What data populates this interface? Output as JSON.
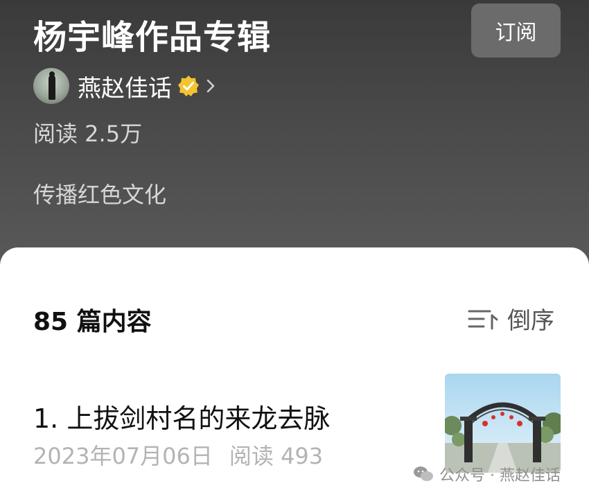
{
  "header": {
    "title": "杨宇峰作品专辑",
    "subscribe_label": "订阅",
    "author": {
      "name": "燕赵佳话",
      "avatar_icon": "person-silhouette-photo",
      "verified_icon": "verified-badge-icon",
      "chevron_icon": "chevron-right-icon"
    },
    "reads": "阅读 2.5万",
    "description": "传播红色文化"
  },
  "list": {
    "count_label": "85 篇内容",
    "sort": {
      "icon": "sort-icon",
      "label": "倒序"
    },
    "items": [
      {
        "title": "1. 上拔剑村名的来龙去脉",
        "date": "2023年07月06日",
        "reads": "阅读 493",
        "thumbnail": "village-gate-photo"
      }
    ]
  },
  "watermark": {
    "icon": "wechat-icon",
    "text": "公众号 · 燕赵佳话"
  },
  "colors": {
    "header_bg": "#4a4a4a",
    "button_bg": "#6b6b6b",
    "verified": "#f4c430",
    "meta_gray": "#b3b3b3"
  }
}
